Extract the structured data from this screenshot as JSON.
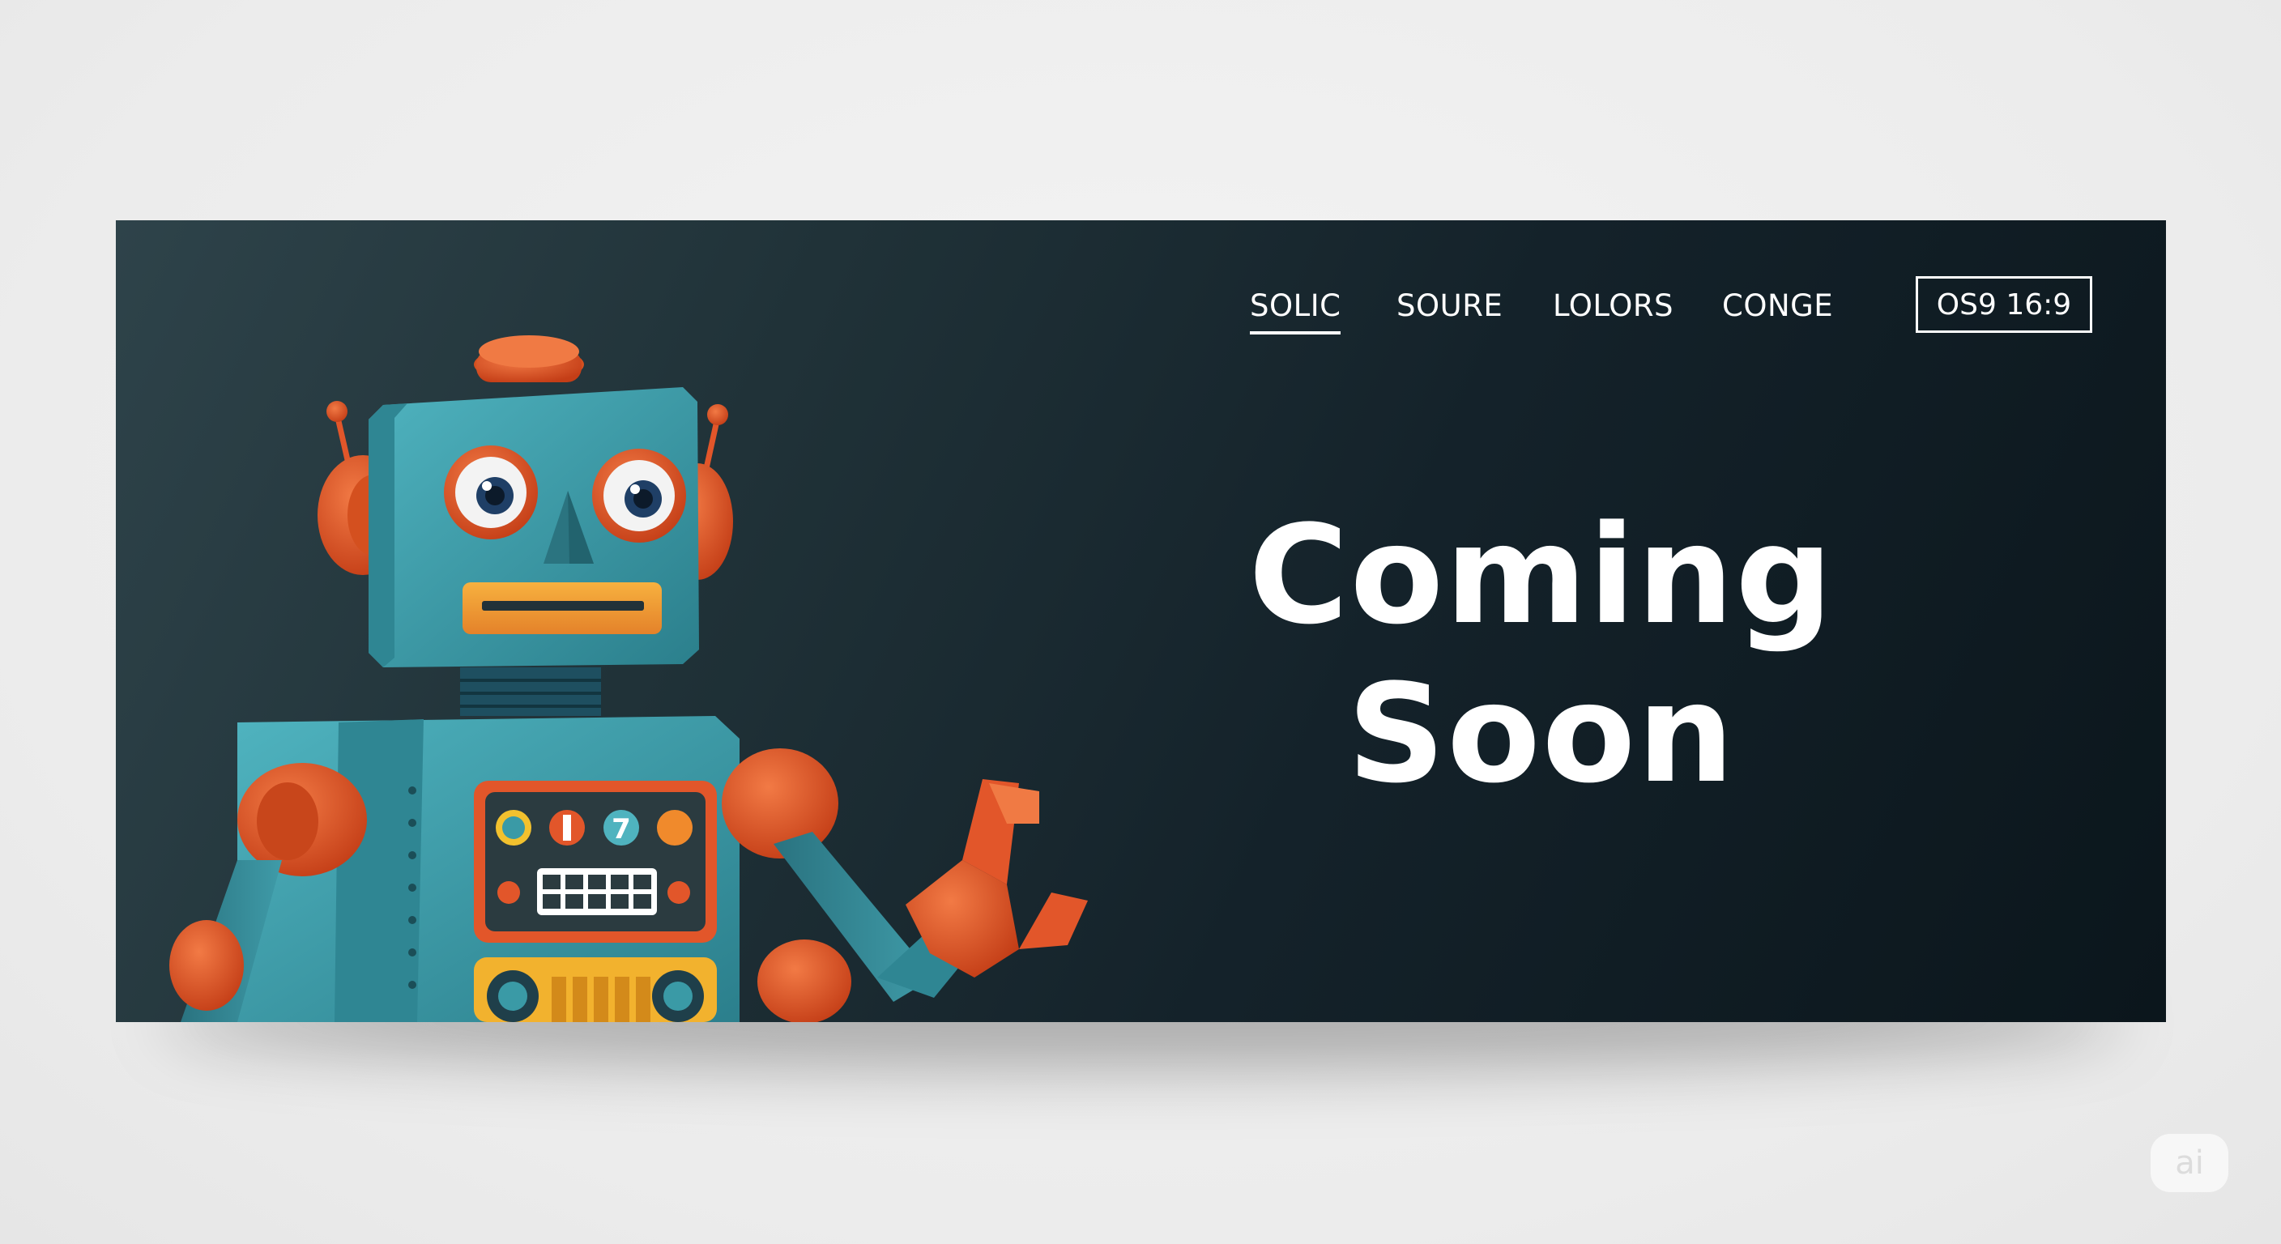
{
  "nav": {
    "items": [
      {
        "label": "SOLIC",
        "active": true
      },
      {
        "label": "SOURE",
        "active": false
      },
      {
        "label": "LOLORS",
        "active": false
      },
      {
        "label": "CONGE",
        "active": false
      }
    ],
    "badge": "OS9 16:9"
  },
  "hero": {
    "line1": "Coming",
    "line2": "Soon"
  },
  "robot": {
    "icon": "robot-illustration",
    "body_color": "#3a9aa6",
    "accent_color": "#e2562a",
    "mouth_color": "#f39a2c",
    "panel_number": "7"
  },
  "watermark": "ai",
  "colors": {
    "background": "#efefef",
    "banner_dark": "#0b161c",
    "banner_light": "#2e434a",
    "text": "#ffffff"
  }
}
